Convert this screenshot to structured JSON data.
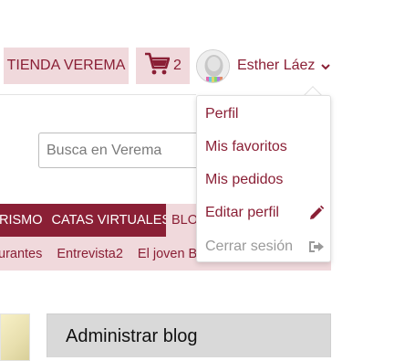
{
  "header": {
    "store_label": "TIENDA VEREMA",
    "cart_count": "2",
    "user_name": "Esther Láez"
  },
  "search": {
    "placeholder": "Busca en Verema"
  },
  "nav": {
    "items": [
      "RISMO",
      "CATAS VIRTUALES"
    ],
    "tail": "BLOG"
  },
  "subnav": {
    "items": [
      "urantes",
      "Entrevista2",
      "El joven B"
    ]
  },
  "widgets": {
    "admin_blog_title": "Administrar blog"
  },
  "dropdown": {
    "items": [
      {
        "label": "Perfil"
      },
      {
        "label": "Mis favoritos"
      },
      {
        "label": "Mis pedidos"
      },
      {
        "label": "Editar perfil",
        "icon": "pencil-icon"
      },
      {
        "label": "Cerrar sesión",
        "icon": "sign-out-icon",
        "disabled": true
      }
    ]
  },
  "colors": {
    "brand": "#8a1f35",
    "brand_light": "#f0d9dc"
  }
}
